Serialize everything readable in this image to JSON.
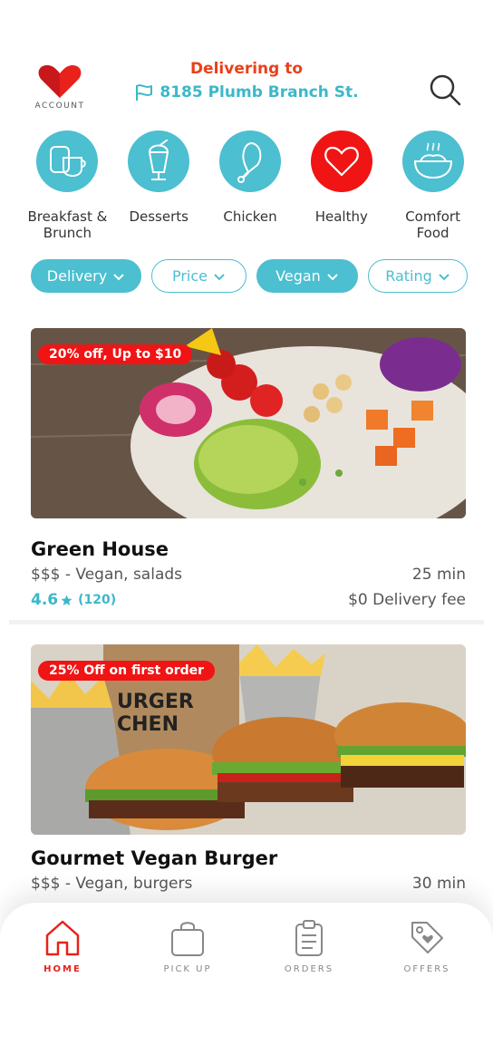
{
  "header": {
    "account_label": "ACCOUNT",
    "deliver_title": "Delivering to",
    "address": "8185 Plumb Branch St."
  },
  "colors": {
    "accent": "#4cbfd0",
    "brand_red": "#f01414",
    "title_orange": "#e8411b"
  },
  "categories": [
    {
      "label": "Breakfast & Brunch",
      "icon": "breakfast-icon",
      "active": false
    },
    {
      "label": "Desserts",
      "icon": "milkshake-icon",
      "active": false
    },
    {
      "label": "Chicken",
      "icon": "drumstick-icon",
      "active": false
    },
    {
      "label": "Healthy",
      "icon": "heart-icon",
      "active": true
    },
    {
      "label": "Comfort Food",
      "icon": "bowl-icon",
      "active": false
    }
  ],
  "filters": [
    {
      "label": "Delivery",
      "selected": true
    },
    {
      "label": "Price",
      "selected": false
    },
    {
      "label": "Vegan",
      "selected": true
    },
    {
      "label": "Rating",
      "selected": false
    }
  ],
  "restaurants": [
    {
      "promo": "20% off, Up to $10",
      "name": "Green House",
      "price_tags": "$$$ - Vegan, salads",
      "time": "25 min",
      "rating": "4.6",
      "rating_count": "(120)",
      "delivery_fee": "$0 Delivery fee"
    },
    {
      "promo": "25% Off on first order",
      "name": "Gourmet Vegan Burger",
      "price_tags": "$$$ - Vegan, burgers",
      "time": "30 min"
    }
  ],
  "nav": [
    {
      "label": "HOME",
      "icon": "home-icon",
      "active": true
    },
    {
      "label": "PICK UP",
      "icon": "shopping-bag-icon",
      "active": false
    },
    {
      "label": "ORDERS",
      "icon": "clipboard-icon",
      "active": false
    },
    {
      "label": "OFFERS",
      "icon": "tag-icon",
      "active": false
    }
  ]
}
